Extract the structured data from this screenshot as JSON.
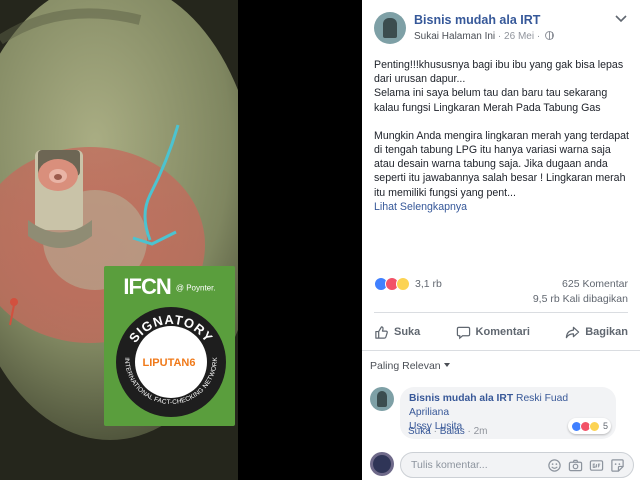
{
  "photo": {
    "badge": {
      "logo": "IFCN",
      "poynter": "@ Poynter.",
      "ring_top": "SIGNATORY",
      "ring_bottom": "INTERNATIONAL FACT-CHECKING NETWORK",
      "partner": "LIPUTAN6"
    }
  },
  "post": {
    "page_name": "Bisnis mudah ala IRT",
    "like_page": "Sukai Halaman Ini",
    "separator": " · ",
    "date": "26 Mei",
    "date_sep": " · ",
    "paragraph1": "Penting!!!khususnya bagi ibu ibu yang gak bisa lepas dari urusan dapur...\nSelama ini saya belum tau dan baru tau sekarang kalau fungsi Lingkaran Merah Pada Tabung Gas",
    "paragraph2": "Mungkin Anda mengira lingkaran merah yang terdapat di tengah tabung LPG itu hanya variasi warna saja atau desain warna tabung saja. Jika dugaan anda seperti itu jawabannya salah besar ! Lingkaran merah itu memiliki fungsi yang pent...",
    "see_more": "Lihat Selengkapnya",
    "reactions_count": "3,1 rb",
    "comments_count": "625 Komentar",
    "shares_count": "9,5 rb Kali dibagikan",
    "actions": {
      "like": "Suka",
      "comment": "Komentari",
      "share": "Bagikan"
    },
    "reaction_colors": {
      "like": "#4080ff",
      "love": "#f25268",
      "wow": "#fcd353"
    },
    "icons": [
      "globe-icon",
      "caret-down-icon",
      "thumbs-up-icon",
      "comment-icon",
      "share-icon"
    ]
  },
  "comments": {
    "sort_label": "Paling Relevan",
    "items": [
      {
        "author": "Bisnis mudah ala IRT",
        "tag1": "Reski Fuad Apriliana",
        "tag2": "Ussy Lusita",
        "like": "Suka",
        "reply": "Balas",
        "time": "2m",
        "reaction_count": "5"
      }
    ],
    "composer_placeholder": "Tulis komentar...",
    "composer_icons": [
      "emoji-icon",
      "camera-icon",
      "gif-icon",
      "sticker-icon"
    ]
  }
}
